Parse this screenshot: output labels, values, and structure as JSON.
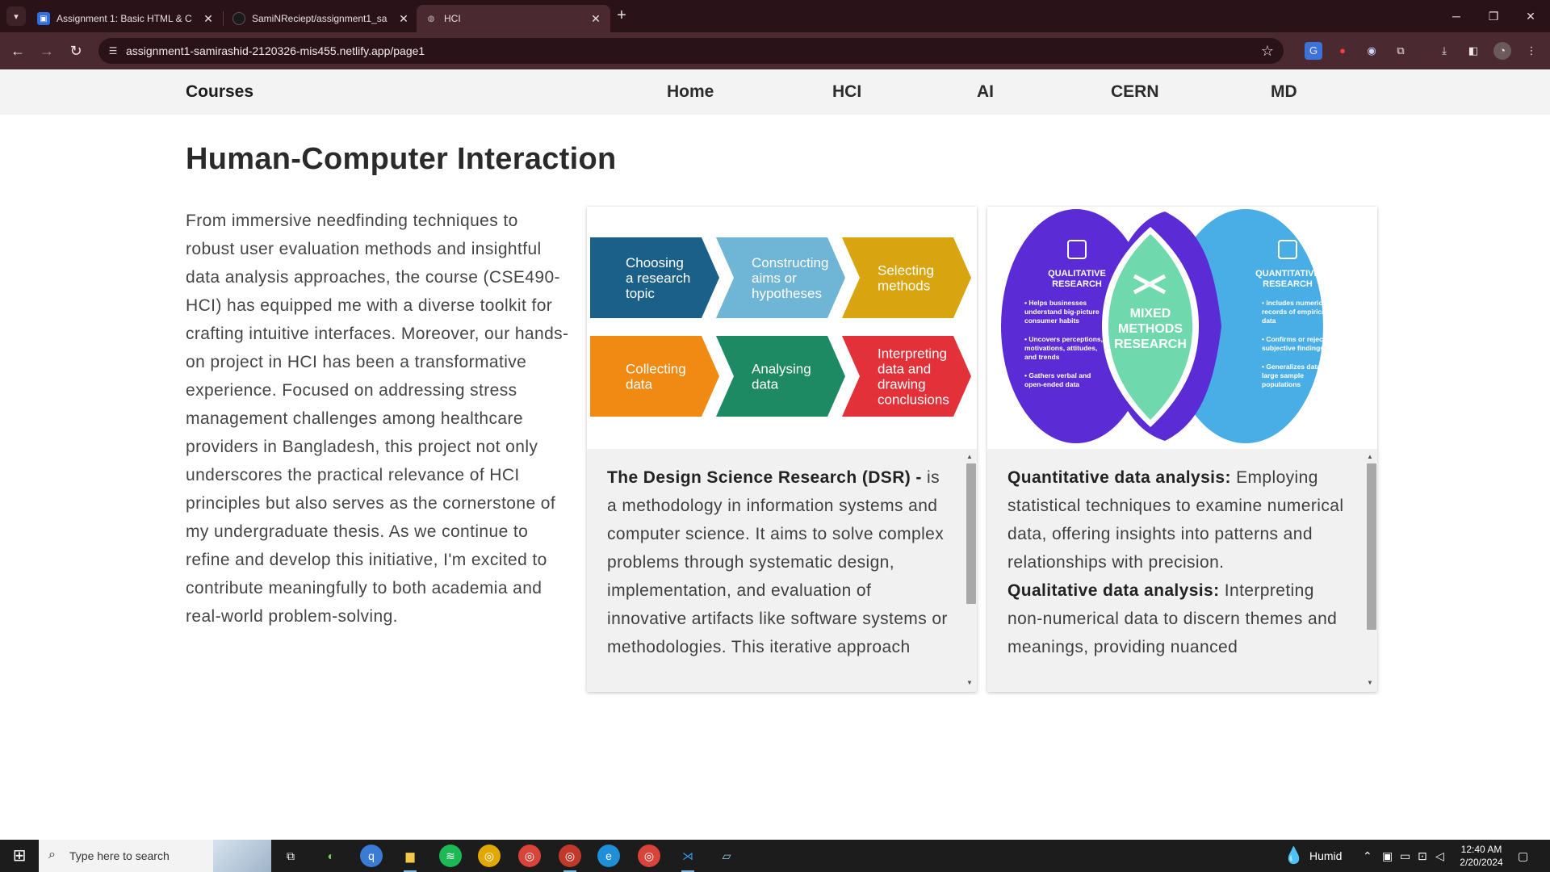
{
  "browser": {
    "tabs": [
      {
        "label": "Assignment 1: Basic HTML & C",
        "active": false,
        "favicon": "classroom-icon"
      },
      {
        "label": "SamiNReciept/assignment1_sa",
        "active": false,
        "favicon": "github-icon"
      },
      {
        "label": "HCI",
        "active": true,
        "favicon": "globe-icon"
      }
    ],
    "url": "assignment1-samirashid-2120326-mis455.netlify.app/page1"
  },
  "site": {
    "brand": "Courses",
    "nav": [
      "Home",
      "HCI",
      "AI",
      "CERN",
      "MD"
    ]
  },
  "page": {
    "title": "Human-Computer Interaction",
    "intro": "From immersive needfinding techniques to robust user evaluation methods and insightful data analysis approaches, the course (CSE490-HCI) has equipped me with a diverse toolkit for crafting intuitive interfaces. Moreover, our hands-on project in HCI has been a transformative experience. Focused on addressing stress management challenges among healthcare providers in Bangladesh, this project not only underscores the practical relevance of HCI principles but also serves as the cornerstone of my undergraduate thesis. As we continue to refine and develop this initiative, I'm excited to contribute meaningfully to both academia and real-world problem-solving."
  },
  "card1": {
    "steps": [
      {
        "label": "Choosing a research topic",
        "lines": [
          "Choosing",
          "a research",
          "topic"
        ],
        "color": "#1b6088"
      },
      {
        "label": "Constructing aims or hypotheses",
        "lines": [
          "Constructing",
          "aims or",
          "hypotheses"
        ],
        "color": "#6fb5d6"
      },
      {
        "label": "Selecting methods",
        "lines": [
          "Selecting",
          "methods"
        ],
        "color": "#d8a511"
      },
      {
        "label": "Collecting data",
        "lines": [
          "Collecting",
          "data"
        ],
        "color": "#f08a12"
      },
      {
        "label": "Analysing data",
        "lines": [
          "Analysing",
          "data"
        ],
        "color": "#1e8a63"
      },
      {
        "label": "Interpreting data and drawing conclusions",
        "lines": [
          "Interpreting",
          "data and",
          "drawing",
          "conclusions"
        ],
        "color": "#e23138"
      }
    ],
    "heading": "The Design Science Research (DSR) -",
    "text": "is a methodology in information systems and computer science. It aims to solve complex problems through systematic design, implementation, and evaluation of innovative artifacts like software systems or methodologies. This iterative approach",
    "scroll_position": 0.06
  },
  "card2": {
    "diagram": {
      "left_title": "QUALITATIVE RESEARCH",
      "left_title_lines": [
        "QUALITATIVE",
        "RESEARCH"
      ],
      "left_points": [
        [
          "• Helps businesses",
          "understand big-picture",
          "consumer habits"
        ],
        [
          "• Uncovers perceptions,",
          "motivations, attitudes,",
          "and trends"
        ],
        [
          "• Gathers verbal and",
          "open-ended data"
        ]
      ],
      "center_title": "MIXED METHODS RESEARCH",
      "center_title_lines": [
        "MIXED",
        "METHODS",
        "RESEARCH"
      ],
      "right_title": "QUANTITATIVE RESEARCH",
      "right_title_lines": [
        "QUANTITATIVE",
        "RESEARCH"
      ],
      "right_points": [
        [
          "• Includes numerical",
          "records of empirical",
          "data"
        ],
        [
          "• Confirms or rejects",
          "subjective findings"
        ],
        [
          "• Generalizes data from",
          "large sample",
          "populations"
        ]
      ],
      "colors": {
        "left": "#5b2bd6",
        "center": "#6fd8ad",
        "right": "#4aaee6"
      }
    },
    "p1_heading": "Quantitative data analysis:",
    "p1_text": " Employing statistical techniques to examine numerical data, offering insights into patterns and relationships with precision.",
    "p2_heading": "Qualitative data analysis:",
    "p2_text": " Interpreting non-numerical data to discern themes and meanings, providing nuanced",
    "scroll_position": 0.06
  },
  "taskbar": {
    "search_placeholder": "Type here to search",
    "weather": "Humid",
    "time": "12:40 AM",
    "date": "2/20/2024"
  }
}
